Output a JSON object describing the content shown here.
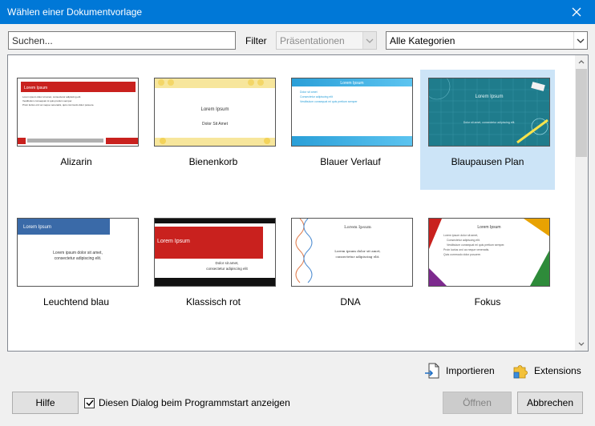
{
  "window": {
    "title": "Wählen einer Dokumentvorlage"
  },
  "search": {
    "placeholder": "Suchen..."
  },
  "filter": {
    "label": "Filter",
    "type_value": "Präsentationen",
    "category_value": "Alle Kategorien"
  },
  "templates": [
    {
      "label": "Alizarin",
      "thumb": {
        "title": "Lorem Ipsum",
        "lines": [
          "Lorem ipsum dolor sit amet, consectetur adipiscing elit.",
          "Vestibulum consequat mi quis pretium semper.",
          "Proin luctus orci ac neque venenatis, quis commodo dolor posuere."
        ]
      }
    },
    {
      "label": "Bienenkorb",
      "thumb": {
        "title": "Lorem Ipsum",
        "subtitle": "Dolor Sit Amet"
      }
    },
    {
      "label": "Blauer Verlauf",
      "thumb": {
        "title": "Lorem Ipsum",
        "lines": [
          "Dolor sit amet",
          "Consectetur adipiscing elit",
          "Vestibulum consequat mi quis pretium semper"
        ]
      }
    },
    {
      "label": "Blaupausen Plan",
      "selected": true,
      "thumb": {
        "title": "Lorem Ipsum",
        "subtitle": "Dolor sit amet, consectetur adipiscing elit."
      }
    },
    {
      "label": "Leuchtend blau",
      "thumb": {
        "title": "Lorem Ipsum",
        "lines": [
          "Lorem ipsum dolor sit amet,",
          "consectetur adipiscing elit."
        ]
      }
    },
    {
      "label": "Klassisch rot",
      "thumb": {
        "title": "Lorem Ipsum",
        "lines": [
          "Dolor sit amet,",
          "consectetur adipiscing elit"
        ]
      }
    },
    {
      "label": "DNA",
      "thumb": {
        "title": "Lorem Ipsum",
        "lines": [
          "Lorem ipsum dolor sit amet,",
          "consectetur adipiscing elit."
        ]
      }
    },
    {
      "label": "Fokus",
      "thumb": {
        "title": "Lorem Ipsum",
        "lines": [
          "Lorem ipsum dolor sit amet,",
          "Consectetur adipiscing elit.",
          "Vestibulum consequat mi quis pretium semper.",
          "Proin luctus orci ac neque venenatis.",
          "Quis commodo dolor posuere."
        ]
      }
    }
  ],
  "links": {
    "import": "Importieren",
    "extensions": "Extensions"
  },
  "footer": {
    "help": "Hilfe",
    "show_on_start": "Diesen Dialog beim Programmstart anzeigen",
    "show_on_start_checked": true,
    "open": "Öffnen",
    "cancel": "Abbrechen"
  },
  "colors": {
    "titlebar": "#0078d7",
    "selection": "#cce4f7",
    "alizarin_red": "#c9211e",
    "blueprint": "#1f7c8c"
  }
}
